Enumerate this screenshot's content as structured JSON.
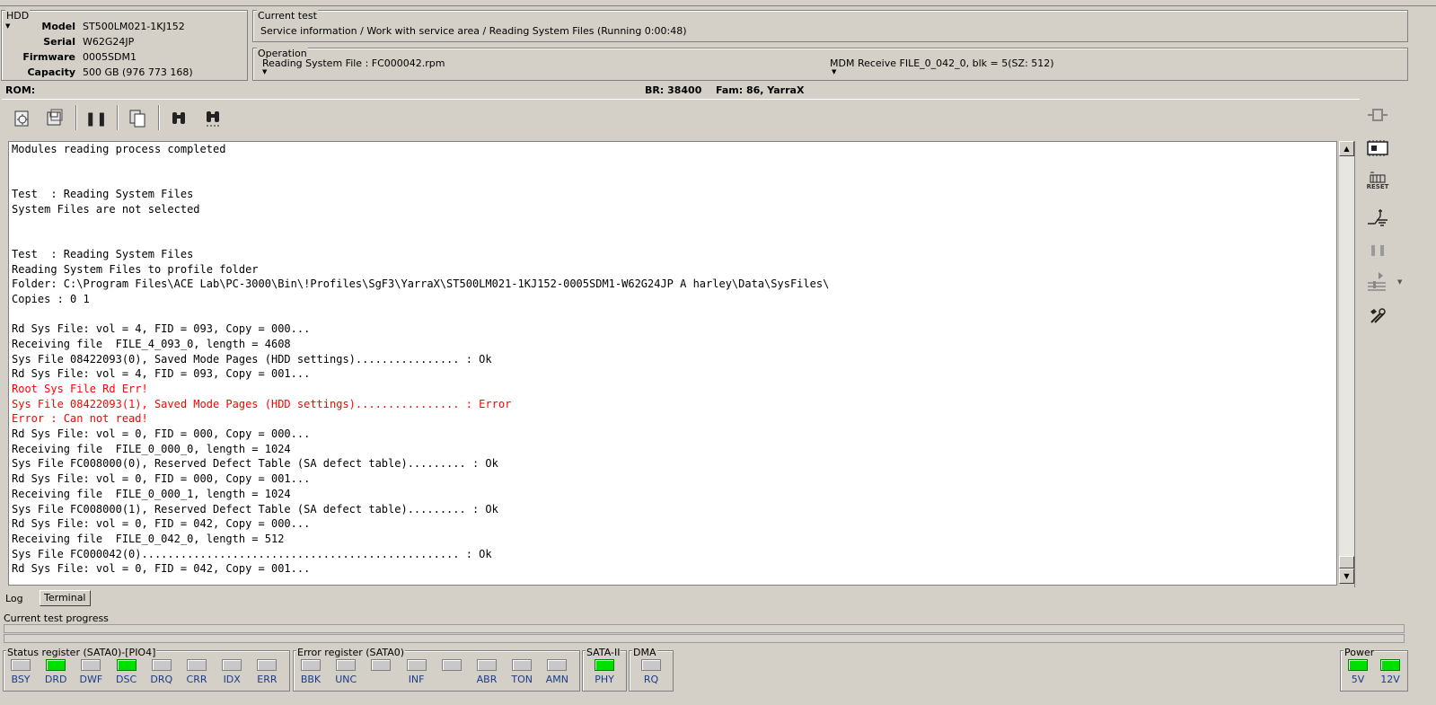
{
  "hdd": {
    "title": "HDD",
    "fields": [
      {
        "label": "Model",
        "value": "ST500LM021-1KJ152"
      },
      {
        "label": "Serial",
        "value": "W62G24JP"
      },
      {
        "label": "Firmware",
        "value": "0005SDM1"
      },
      {
        "label": "Capacity",
        "value": "500 GB (976 773 168)"
      }
    ]
  },
  "current_test": {
    "title": "Current test",
    "text": "Service information / Work with service area / Reading System Files (Running 0:00:48)"
  },
  "operation": {
    "title": "Operation",
    "left": "Reading System File : FC000042.rpm",
    "right": "MDM Receive FILE_0_042_0, blk = 5(SZ: 512)"
  },
  "rom_bar": {
    "rom": "ROM:",
    "br": "BR: 38400",
    "fam": "Fam: 86, YarraX"
  },
  "toolbar_icons": [
    "module-read-icon",
    "save-module-icon",
    "pause-icon",
    "copy-icon",
    "find-icon",
    "find-next-icon"
  ],
  "log_lines": [
    {
      "text": "Modules reading process completed",
      "error": false
    },
    {
      "text": "",
      "error": false
    },
    {
      "text": "",
      "error": false
    },
    {
      "text": "Test  : Reading System Files",
      "error": false
    },
    {
      "text": "System Files are not selected",
      "error": false
    },
    {
      "text": "",
      "error": false
    },
    {
      "text": "",
      "error": false
    },
    {
      "text": "Test  : Reading System Files",
      "error": false
    },
    {
      "text": "Reading System Files to profile folder",
      "error": false
    },
    {
      "text": "Folder: C:\\Program Files\\ACE Lab\\PC-3000\\Bin\\!Profiles\\SgF3\\YarraX\\ST500LM021-1KJ152-0005SDM1-W62G24JP A harley\\Data\\SysFiles\\",
      "error": false
    },
    {
      "text": "Copies : 0 1",
      "error": false
    },
    {
      "text": "",
      "error": false
    },
    {
      "text": "Rd Sys File: vol = 4, FID = 093, Copy = 000...",
      "error": false
    },
    {
      "text": "Receiving file  FILE_4_093_0, length = 4608",
      "error": false
    },
    {
      "text": "Sys File 08422093(0), Saved Mode Pages (HDD settings)................ : Ok",
      "error": false
    },
    {
      "text": "Rd Sys File: vol = 4, FID = 093, Copy = 001...",
      "error": false
    },
    {
      "text": "Root Sys File Rd Err!",
      "error": true
    },
    {
      "text": "Sys File 08422093(1), Saved Mode Pages (HDD settings)................ : Error",
      "error": true
    },
    {
      "text": "Error : Can not read!",
      "error": true
    },
    {
      "text": "Rd Sys File: vol = 0, FID = 000, Copy = 000...",
      "error": false
    },
    {
      "text": "Receiving file  FILE_0_000_0, length = 1024",
      "error": false
    },
    {
      "text": "Sys File FC008000(0), Reserved Defect Table (SA defect table)......... : Ok",
      "error": false
    },
    {
      "text": "Rd Sys File: vol = 0, FID = 000, Copy = 001...",
      "error": false
    },
    {
      "text": "Receiving file  FILE_0_000_1, length = 1024",
      "error": false
    },
    {
      "text": "Sys File FC008000(1), Reserved Defect Table (SA defect table)......... : Ok",
      "error": false
    },
    {
      "text": "Rd Sys File: vol = 0, FID = 042, Copy = 000...",
      "error": false
    },
    {
      "text": "Receiving file  FILE_0_042_0, length = 512",
      "error": false
    },
    {
      "text": "Sys File FC000042(0)................................................. : Ok",
      "error": false
    },
    {
      "text": "Rd Sys File: vol = 0, FID = 042, Copy = 001...",
      "error": false
    }
  ],
  "tabs": [
    {
      "label": "Log",
      "active": true
    },
    {
      "label": "Terminal",
      "active": false
    }
  ],
  "progress": {
    "label": "Current test progress",
    "value": 0
  },
  "status_register": {
    "title": "Status register (SATA0)-[PIO4]",
    "leds": [
      {
        "label": "BSY",
        "on": false
      },
      {
        "label": "DRD",
        "on": true
      },
      {
        "label": "DWF",
        "on": false
      },
      {
        "label": "DSC",
        "on": true
      },
      {
        "label": "DRQ",
        "on": false
      },
      {
        "label": "CRR",
        "on": false
      },
      {
        "label": "IDX",
        "on": false
      },
      {
        "label": "ERR",
        "on": false
      }
    ]
  },
  "error_register": {
    "title": "Error register (SATA0)",
    "leds": [
      {
        "label": "BBK",
        "on": false
      },
      {
        "label": "UNC",
        "on": false
      },
      {
        "label": "",
        "on": false
      },
      {
        "label": "INF",
        "on": false
      },
      {
        "label": "",
        "on": false
      },
      {
        "label": "ABR",
        "on": false
      },
      {
        "label": "TON",
        "on": false
      },
      {
        "label": "AMN",
        "on": false
      }
    ]
  },
  "sata": {
    "title": "SATA-II",
    "leds": [
      {
        "label": "PHY",
        "on": true
      }
    ]
  },
  "dma": {
    "title": "DMA",
    "leds": [
      {
        "label": "RQ",
        "on": false
      }
    ]
  },
  "power": {
    "title": "Power",
    "leds": [
      {
        "label": "5V",
        "on": true
      },
      {
        "label": "12V",
        "on": true
      }
    ]
  },
  "right_tools": {
    "reset_label": "RESET"
  },
  "colors": {
    "background": "#d4d0c8",
    "led_on": "#00e000",
    "error_text": "#ff0000",
    "label_blue": "#1a3a8a"
  }
}
